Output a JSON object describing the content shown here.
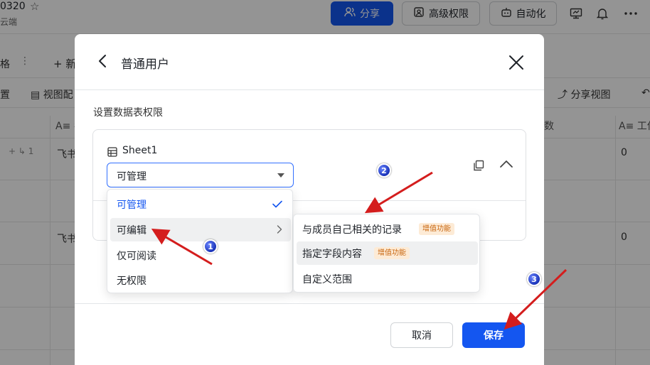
{
  "app": {
    "doc_title": "0320",
    "doc_subtitle": "云端",
    "toolbar": {
      "share_label": "分享",
      "advanced_perm_label": "高级权限",
      "automation_label": "自动化"
    },
    "row2": {
      "tab_label": "格",
      "add_label": "+ 新"
    },
    "row3": {
      "left_label": "置",
      "view_label": "视图配",
      "share_view_label": "分享视图"
    },
    "grid": {
      "col_left_header": "A≡ 名",
      "col_right_header": "A≡ 工作",
      "col_mid_header": "数",
      "rows": [
        {
          "name": "飞书",
          "value": "0"
        },
        {
          "name": "飞书",
          "value": "0"
        }
      ],
      "row_tools": "+  ↳ 1"
    }
  },
  "dialog": {
    "title": "普通用户",
    "section_label": "设置数据表权限",
    "sheet": {
      "name": "Sheet1",
      "selected_value": "可管理"
    },
    "cancel_label": "取消",
    "save_label": "保存"
  },
  "menu": {
    "items": [
      {
        "label": "可管理",
        "selected": true
      },
      {
        "label": "可编辑",
        "has_submenu": true
      },
      {
        "label": "仅可阅读"
      },
      {
        "label": "无权限"
      }
    ]
  },
  "submenu": {
    "items": [
      {
        "label": "与成员自己相关的记录",
        "badge": "增值功能"
      },
      {
        "label": "指定字段内容",
        "badge": "增值功能"
      },
      {
        "label": "自定义范围"
      }
    ]
  },
  "annotations": {
    "markers": [
      "1",
      "2",
      "3"
    ],
    "arrow_color": "#d41d1d"
  },
  "colors": {
    "primary": "#1456f0",
    "badge_bg": "#fdebd6",
    "badge_text": "#c8650d"
  }
}
